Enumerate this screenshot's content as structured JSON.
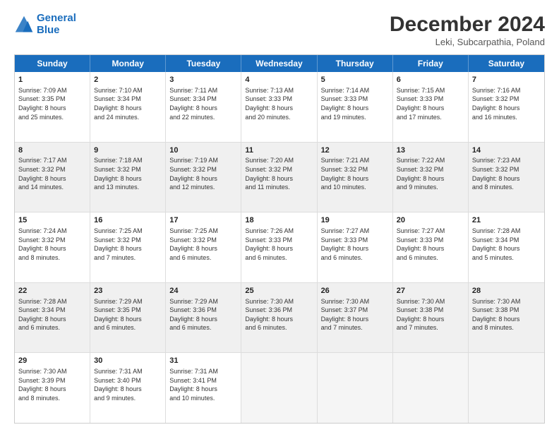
{
  "logo": {
    "line1": "General",
    "line2": "Blue"
  },
  "title": "December 2024",
  "location": "Leki, Subcarpathia, Poland",
  "header_days": [
    "Sunday",
    "Monday",
    "Tuesday",
    "Wednesday",
    "Thursday",
    "Friday",
    "Saturday"
  ],
  "rows": [
    [
      {
        "day": "1",
        "lines": [
          "Sunrise: 7:09 AM",
          "Sunset: 3:35 PM",
          "Daylight: 8 hours",
          "and 25 minutes."
        ],
        "shaded": false
      },
      {
        "day": "2",
        "lines": [
          "Sunrise: 7:10 AM",
          "Sunset: 3:34 PM",
          "Daylight: 8 hours",
          "and 24 minutes."
        ],
        "shaded": false
      },
      {
        "day": "3",
        "lines": [
          "Sunrise: 7:11 AM",
          "Sunset: 3:34 PM",
          "Daylight: 8 hours",
          "and 22 minutes."
        ],
        "shaded": false
      },
      {
        "day": "4",
        "lines": [
          "Sunrise: 7:13 AM",
          "Sunset: 3:33 PM",
          "Daylight: 8 hours",
          "and 20 minutes."
        ],
        "shaded": false
      },
      {
        "day": "5",
        "lines": [
          "Sunrise: 7:14 AM",
          "Sunset: 3:33 PM",
          "Daylight: 8 hours",
          "and 19 minutes."
        ],
        "shaded": false
      },
      {
        "day": "6",
        "lines": [
          "Sunrise: 7:15 AM",
          "Sunset: 3:33 PM",
          "Daylight: 8 hours",
          "and 17 minutes."
        ],
        "shaded": false
      },
      {
        "day": "7",
        "lines": [
          "Sunrise: 7:16 AM",
          "Sunset: 3:32 PM",
          "Daylight: 8 hours",
          "and 16 minutes."
        ],
        "shaded": false
      }
    ],
    [
      {
        "day": "8",
        "lines": [
          "Sunrise: 7:17 AM",
          "Sunset: 3:32 PM",
          "Daylight: 8 hours",
          "and 14 minutes."
        ],
        "shaded": true
      },
      {
        "day": "9",
        "lines": [
          "Sunrise: 7:18 AM",
          "Sunset: 3:32 PM",
          "Daylight: 8 hours",
          "and 13 minutes."
        ],
        "shaded": true
      },
      {
        "day": "10",
        "lines": [
          "Sunrise: 7:19 AM",
          "Sunset: 3:32 PM",
          "Daylight: 8 hours",
          "and 12 minutes."
        ],
        "shaded": true
      },
      {
        "day": "11",
        "lines": [
          "Sunrise: 7:20 AM",
          "Sunset: 3:32 PM",
          "Daylight: 8 hours",
          "and 11 minutes."
        ],
        "shaded": true
      },
      {
        "day": "12",
        "lines": [
          "Sunrise: 7:21 AM",
          "Sunset: 3:32 PM",
          "Daylight: 8 hours",
          "and 10 minutes."
        ],
        "shaded": true
      },
      {
        "day": "13",
        "lines": [
          "Sunrise: 7:22 AM",
          "Sunset: 3:32 PM",
          "Daylight: 8 hours",
          "and 9 minutes."
        ],
        "shaded": true
      },
      {
        "day": "14",
        "lines": [
          "Sunrise: 7:23 AM",
          "Sunset: 3:32 PM",
          "Daylight: 8 hours",
          "and 8 minutes."
        ],
        "shaded": true
      }
    ],
    [
      {
        "day": "15",
        "lines": [
          "Sunrise: 7:24 AM",
          "Sunset: 3:32 PM",
          "Daylight: 8 hours",
          "and 8 minutes."
        ],
        "shaded": false
      },
      {
        "day": "16",
        "lines": [
          "Sunrise: 7:25 AM",
          "Sunset: 3:32 PM",
          "Daylight: 8 hours",
          "and 7 minutes."
        ],
        "shaded": false
      },
      {
        "day": "17",
        "lines": [
          "Sunrise: 7:25 AM",
          "Sunset: 3:32 PM",
          "Daylight: 8 hours",
          "and 6 minutes."
        ],
        "shaded": false
      },
      {
        "day": "18",
        "lines": [
          "Sunrise: 7:26 AM",
          "Sunset: 3:33 PM",
          "Daylight: 8 hours",
          "and 6 minutes."
        ],
        "shaded": false
      },
      {
        "day": "19",
        "lines": [
          "Sunrise: 7:27 AM",
          "Sunset: 3:33 PM",
          "Daylight: 8 hours",
          "and 6 minutes."
        ],
        "shaded": false
      },
      {
        "day": "20",
        "lines": [
          "Sunrise: 7:27 AM",
          "Sunset: 3:33 PM",
          "Daylight: 8 hours",
          "and 6 minutes."
        ],
        "shaded": false
      },
      {
        "day": "21",
        "lines": [
          "Sunrise: 7:28 AM",
          "Sunset: 3:34 PM",
          "Daylight: 8 hours",
          "and 5 minutes."
        ],
        "shaded": false
      }
    ],
    [
      {
        "day": "22",
        "lines": [
          "Sunrise: 7:28 AM",
          "Sunset: 3:34 PM",
          "Daylight: 8 hours",
          "and 6 minutes."
        ],
        "shaded": true
      },
      {
        "day": "23",
        "lines": [
          "Sunrise: 7:29 AM",
          "Sunset: 3:35 PM",
          "Daylight: 8 hours",
          "and 6 minutes."
        ],
        "shaded": true
      },
      {
        "day": "24",
        "lines": [
          "Sunrise: 7:29 AM",
          "Sunset: 3:36 PM",
          "Daylight: 8 hours",
          "and 6 minutes."
        ],
        "shaded": true
      },
      {
        "day": "25",
        "lines": [
          "Sunrise: 7:30 AM",
          "Sunset: 3:36 PM",
          "Daylight: 8 hours",
          "and 6 minutes."
        ],
        "shaded": true
      },
      {
        "day": "26",
        "lines": [
          "Sunrise: 7:30 AM",
          "Sunset: 3:37 PM",
          "Daylight: 8 hours",
          "and 7 minutes."
        ],
        "shaded": true
      },
      {
        "day": "27",
        "lines": [
          "Sunrise: 7:30 AM",
          "Sunset: 3:38 PM",
          "Daylight: 8 hours",
          "and 7 minutes."
        ],
        "shaded": true
      },
      {
        "day": "28",
        "lines": [
          "Sunrise: 7:30 AM",
          "Sunset: 3:38 PM",
          "Daylight: 8 hours",
          "and 8 minutes."
        ],
        "shaded": true
      }
    ],
    [
      {
        "day": "29",
        "lines": [
          "Sunrise: 7:30 AM",
          "Sunset: 3:39 PM",
          "Daylight: 8 hours",
          "and 8 minutes."
        ],
        "shaded": false
      },
      {
        "day": "30",
        "lines": [
          "Sunrise: 7:31 AM",
          "Sunset: 3:40 PM",
          "Daylight: 8 hours",
          "and 9 minutes."
        ],
        "shaded": false
      },
      {
        "day": "31",
        "lines": [
          "Sunrise: 7:31 AM",
          "Sunset: 3:41 PM",
          "Daylight: 8 hours",
          "and 10 minutes."
        ],
        "shaded": false
      },
      {
        "day": "",
        "lines": [],
        "shaded": true,
        "empty": true
      },
      {
        "day": "",
        "lines": [],
        "shaded": true,
        "empty": true
      },
      {
        "day": "",
        "lines": [],
        "shaded": true,
        "empty": true
      },
      {
        "day": "",
        "lines": [],
        "shaded": true,
        "empty": true
      }
    ]
  ]
}
